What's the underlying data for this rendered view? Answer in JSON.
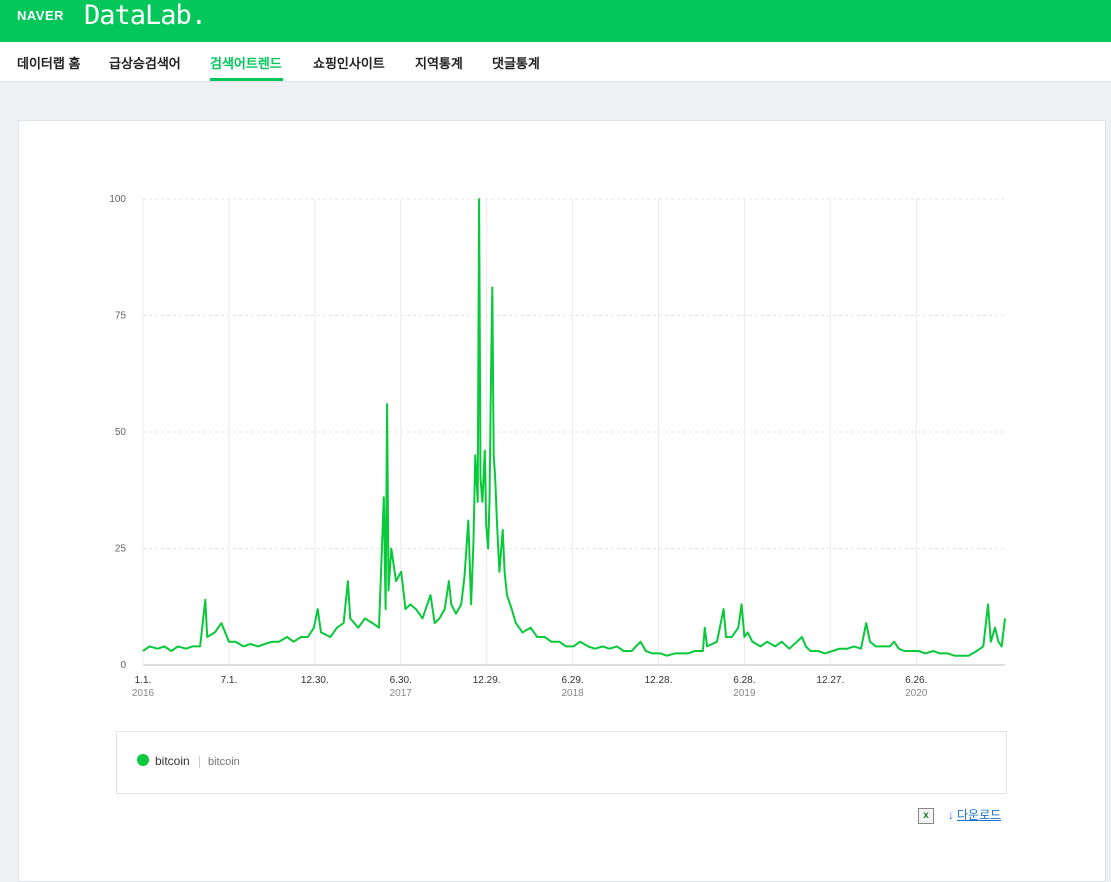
{
  "header": {
    "naver_label": "NAVER",
    "datalab_label": "DataLab."
  },
  "nav": {
    "items": [
      {
        "label": "데이터랩 홈"
      },
      {
        "label": "급상승검색어"
      },
      {
        "label": "검색어트렌드",
        "active": true
      },
      {
        "label": "쇼핑인사이트"
      },
      {
        "label": "지역통계"
      },
      {
        "label": "댓글통계"
      }
    ]
  },
  "accent_color": "#03c75a",
  "series_color": "#08c93a",
  "chart_data": {
    "type": "line",
    "title": "",
    "xlabel": "",
    "ylabel": "",
    "x_range": [
      "2016-01-01",
      "2020-12-31"
    ],
    "ylim": [
      0,
      100
    ],
    "y_ticks": [
      0,
      25,
      50,
      75,
      100
    ],
    "x_ticks": [
      {
        "date": "2016-01-01",
        "label": "1.1.",
        "year": "2016"
      },
      {
        "date": "2016-07-01",
        "label": "7.1.",
        "year": ""
      },
      {
        "date": "2016-12-30",
        "label": "12.30.",
        "year": ""
      },
      {
        "date": "2017-06-30",
        "label": "6.30.",
        "year": "2017"
      },
      {
        "date": "2017-12-29",
        "label": "12.29.",
        "year": ""
      },
      {
        "date": "2018-06-29",
        "label": "6.29.",
        "year": "2018"
      },
      {
        "date": "2018-12-28",
        "label": "12.28.",
        "year": ""
      },
      {
        "date": "2019-06-28",
        "label": "6.28.",
        "year": "2019"
      },
      {
        "date": "2019-12-27",
        "label": "12.27.",
        "year": ""
      },
      {
        "date": "2020-06-26",
        "label": "6.26.",
        "year": "2020"
      }
    ],
    "grid": true,
    "legend_position": "bottom",
    "series": [
      {
        "name": "bitcoin",
        "keyword": "bitcoin",
        "points": [
          [
            "2016-01-01",
            3
          ],
          [
            "2016-01-15",
            4
          ],
          [
            "2016-02-01",
            3.5
          ],
          [
            "2016-02-15",
            4
          ],
          [
            "2016-03-01",
            3
          ],
          [
            "2016-03-15",
            4
          ],
          [
            "2016-04-01",
            3.5
          ],
          [
            "2016-04-15",
            4
          ],
          [
            "2016-05-01",
            4
          ],
          [
            "2016-05-12",
            14
          ],
          [
            "2016-05-16",
            6
          ],
          [
            "2016-06-01",
            7
          ],
          [
            "2016-06-15",
            9
          ],
          [
            "2016-07-01",
            5
          ],
          [
            "2016-07-15",
            5
          ],
          [
            "2016-08-01",
            4
          ],
          [
            "2016-08-15",
            4.5
          ],
          [
            "2016-09-01",
            4
          ],
          [
            "2016-09-15",
            4.5
          ],
          [
            "2016-10-01",
            5
          ],
          [
            "2016-10-15",
            5
          ],
          [
            "2016-11-01",
            6
          ],
          [
            "2016-11-15",
            5
          ],
          [
            "2016-12-01",
            6
          ],
          [
            "2016-12-15",
            6
          ],
          [
            "2016-12-28",
            8
          ],
          [
            "2017-01-05",
            12
          ],
          [
            "2017-01-12",
            7
          ],
          [
            "2017-02-01",
            6
          ],
          [
            "2017-02-15",
            8
          ],
          [
            "2017-03-01",
            9
          ],
          [
            "2017-03-10",
            18
          ],
          [
            "2017-03-15",
            10
          ],
          [
            "2017-04-01",
            8
          ],
          [
            "2017-04-15",
            10
          ],
          [
            "2017-05-01",
            9
          ],
          [
            "2017-05-15",
            8
          ],
          [
            "2017-05-25",
            36
          ],
          [
            "2017-05-29",
            12
          ],
          [
            "2017-06-01",
            56
          ],
          [
            "2017-06-04",
            16
          ],
          [
            "2017-06-10",
            25
          ],
          [
            "2017-06-20",
            18
          ],
          [
            "2017-07-01",
            20
          ],
          [
            "2017-07-10",
            12
          ],
          [
            "2017-07-20",
            13
          ],
          [
            "2017-08-01",
            12
          ],
          [
            "2017-08-15",
            10
          ],
          [
            "2017-09-01",
            15
          ],
          [
            "2017-09-10",
            9
          ],
          [
            "2017-09-20",
            10
          ],
          [
            "2017-10-01",
            12
          ],
          [
            "2017-10-10",
            18
          ],
          [
            "2017-10-15",
            13
          ],
          [
            "2017-10-25",
            11
          ],
          [
            "2017-11-05",
            13
          ],
          [
            "2017-11-12",
            19
          ],
          [
            "2017-11-20",
            31
          ],
          [
            "2017-11-26",
            13
          ],
          [
            "2017-12-01",
            26
          ],
          [
            "2017-12-05",
            45
          ],
          [
            "2017-12-10",
            35
          ],
          [
            "2017-12-13",
            100
          ],
          [
            "2017-12-16",
            40
          ],
          [
            "2017-12-20",
            35
          ],
          [
            "2017-12-25",
            46
          ],
          [
            "2017-12-28",
            30
          ],
          [
            "2018-01-01",
            25
          ],
          [
            "2018-01-04",
            35
          ],
          [
            "2018-01-07",
            60
          ],
          [
            "2018-01-10",
            81
          ],
          [
            "2018-01-13",
            45
          ],
          [
            "2018-01-16",
            40
          ],
          [
            "2018-01-20",
            30
          ],
          [
            "2018-01-25",
            20
          ],
          [
            "2018-02-01",
            29
          ],
          [
            "2018-02-05",
            20
          ],
          [
            "2018-02-10",
            15
          ],
          [
            "2018-02-20",
            12
          ],
          [
            "2018-03-01",
            9
          ],
          [
            "2018-03-15",
            7
          ],
          [
            "2018-04-01",
            8
          ],
          [
            "2018-04-15",
            6
          ],
          [
            "2018-05-01",
            6
          ],
          [
            "2018-05-15",
            5
          ],
          [
            "2018-06-01",
            5
          ],
          [
            "2018-06-15",
            4
          ],
          [
            "2018-07-01",
            4
          ],
          [
            "2018-07-15",
            5
          ],
          [
            "2018-08-01",
            4
          ],
          [
            "2018-08-15",
            3.5
          ],
          [
            "2018-09-01",
            4
          ],
          [
            "2018-09-15",
            3.5
          ],
          [
            "2018-10-01",
            4
          ],
          [
            "2018-10-15",
            3
          ],
          [
            "2018-11-01",
            3
          ],
          [
            "2018-11-20",
            5
          ],
          [
            "2018-12-01",
            3
          ],
          [
            "2018-12-15",
            2.5
          ],
          [
            "2019-01-01",
            2.5
          ],
          [
            "2019-01-15",
            2
          ],
          [
            "2019-02-01",
            2.5
          ],
          [
            "2019-02-15",
            2.5
          ],
          [
            "2019-03-01",
            2.5
          ],
          [
            "2019-03-15",
            3
          ],
          [
            "2019-04-01",
            3
          ],
          [
            "2019-04-05",
            8
          ],
          [
            "2019-04-10",
            4
          ],
          [
            "2019-05-01",
            5
          ],
          [
            "2019-05-15",
            12
          ],
          [
            "2019-05-20",
            6
          ],
          [
            "2019-06-01",
            6
          ],
          [
            "2019-06-15",
            8
          ],
          [
            "2019-06-22",
            13
          ],
          [
            "2019-06-28",
            6
          ],
          [
            "2019-07-05",
            7
          ],
          [
            "2019-07-15",
            5
          ],
          [
            "2019-08-01",
            4
          ],
          [
            "2019-08-15",
            5
          ],
          [
            "2019-09-01",
            4
          ],
          [
            "2019-09-15",
            5
          ],
          [
            "2019-10-01",
            3.5
          ],
          [
            "2019-10-28",
            6
          ],
          [
            "2019-11-05",
            4
          ],
          [
            "2019-11-15",
            3
          ],
          [
            "2019-12-01",
            3
          ],
          [
            "2019-12-15",
            2.5
          ],
          [
            "2020-01-01",
            3
          ],
          [
            "2020-01-15",
            3.5
          ],
          [
            "2020-02-01",
            3.5
          ],
          [
            "2020-02-15",
            4
          ],
          [
            "2020-03-01",
            3.5
          ],
          [
            "2020-03-12",
            9
          ],
          [
            "2020-03-20",
            5
          ],
          [
            "2020-04-01",
            4
          ],
          [
            "2020-04-15",
            4
          ],
          [
            "2020-05-01",
            4
          ],
          [
            "2020-05-10",
            5
          ],
          [
            "2020-05-20",
            3.5
          ],
          [
            "2020-06-01",
            3
          ],
          [
            "2020-06-15",
            3
          ],
          [
            "2020-07-01",
            3
          ],
          [
            "2020-07-15",
            2.5
          ],
          [
            "2020-08-01",
            3
          ],
          [
            "2020-08-15",
            2.5
          ],
          [
            "2020-09-01",
            2.5
          ],
          [
            "2020-09-15",
            2
          ],
          [
            "2020-10-01",
            2
          ],
          [
            "2020-10-15",
            2
          ],
          [
            "2020-11-01",
            3
          ],
          [
            "2020-11-15",
            4
          ],
          [
            "2020-11-25",
            13
          ],
          [
            "2020-12-01",
            5
          ],
          [
            "2020-12-10",
            8
          ],
          [
            "2020-12-17",
            5
          ],
          [
            "2020-12-24",
            4
          ],
          [
            "2020-12-31",
            10
          ]
        ]
      }
    ]
  },
  "legend": {
    "series_name": "bitcoin",
    "keyword": "bitcoin"
  },
  "actions": {
    "excel_icon": "excel-icon",
    "excel_glyph": "x",
    "download_label": "다운로드",
    "download_glyph": "↓"
  }
}
